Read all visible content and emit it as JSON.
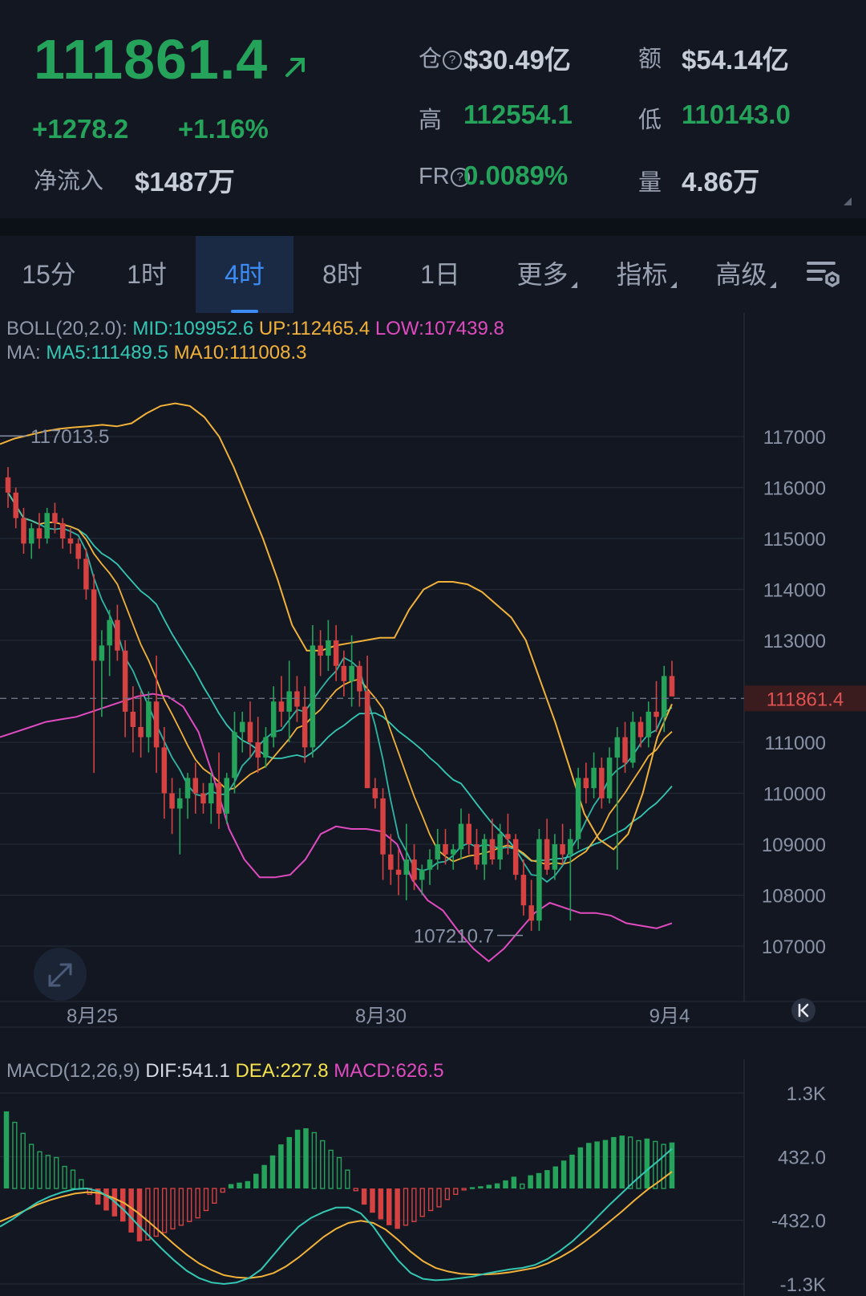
{
  "header": {
    "price": "111861.4",
    "change_abs": "+1278.2",
    "change_pct": "+1.16%",
    "net_inflow_label": "净流入",
    "net_inflow_value": "$1487万",
    "open_interest_label": "仓",
    "open_interest_value": "$30.49亿",
    "turnover_label": "额",
    "turnover_value": "$54.14亿",
    "high_label": "高",
    "high_value": "112554.1",
    "low_label": "低",
    "low_value": "110143.0",
    "funding_rate_label": "FR",
    "funding_rate_value": "0.0089%",
    "volume_label": "量",
    "volume_value": "4.86万",
    "up_color": "#26a35b",
    "down_color": "#d64141"
  },
  "tabs": [
    {
      "label": "15分",
      "active": false
    },
    {
      "label": "1时",
      "active": false
    },
    {
      "label": "4时",
      "active": true
    },
    {
      "label": "8时",
      "active": false
    },
    {
      "label": "1日",
      "active": false
    },
    {
      "label": "更多",
      "active": false
    },
    {
      "label": "指标",
      "active": false
    },
    {
      "label": "高级",
      "active": false
    }
  ],
  "indicators": {
    "boll_name": "BOLL(20,2.0):",
    "boll_mid": "MID:109952.6",
    "boll_up": "UP:112465.4",
    "boll_low": "LOW:107439.8",
    "ma_name": "MA:",
    "ma5": "MA5:111489.5",
    "ma10": "MA10:111008.3",
    "macd_name": "MACD(12,26,9)",
    "macd_dif": "DIF:541.1",
    "macd_dea": "DEA:227.8",
    "macd_val": "MACD:626.5"
  },
  "chart_data": [
    {
      "type": "candlestick",
      "price_axis_ticks": [
        "117000",
        "116000",
        "115000",
        "114000",
        "113000",
        "111000",
        "110000",
        "109000",
        "108000",
        "107000"
      ],
      "current_price_label": "111861.4",
      "x_labels": [
        "8月25",
        "8月30",
        "9月4"
      ],
      "annotations": {
        "high": "117013.5",
        "low": "107210.7"
      },
      "candles": [
        [
          116200,
          116400,
          115600,
          115900
        ],
        [
          115900,
          116000,
          115200,
          115400
        ],
        [
          115400,
          115600,
          114700,
          114900
        ],
        [
          114900,
          115300,
          114600,
          115200
        ],
        [
          115200,
          115500,
          114800,
          115000
        ],
        [
          115000,
          115600,
          114900,
          115500
        ],
        [
          115500,
          115700,
          115100,
          115300
        ],
        [
          115300,
          115400,
          114800,
          115000
        ],
        [
          115000,
          115200,
          114700,
          114900
        ],
        [
          114900,
          115000,
          114400,
          114600
        ],
        [
          114600,
          114800,
          113800,
          114000
        ],
        [
          114000,
          114300,
          110400,
          112600
        ],
        [
          112600,
          113200,
          111500,
          112900
        ],
        [
          112900,
          113600,
          112300,
          113400
        ],
        [
          113400,
          113700,
          112600,
          112800
        ],
        [
          112800,
          113000,
          111100,
          111600
        ],
        [
          111600,
          112100,
          110800,
          111300
        ],
        [
          111300,
          112000,
          110700,
          111100
        ],
        [
          111100,
          112000,
          110800,
          111800
        ],
        [
          111800,
          112700,
          110400,
          110900
        ],
        [
          110900,
          111300,
          109500,
          110000
        ],
        [
          110000,
          110300,
          109200,
          109700
        ],
        [
          109700,
          110100,
          108800,
          109900
        ],
        [
          109900,
          110400,
          109500,
          110300
        ],
        [
          110300,
          110600,
          109600,
          110000
        ],
        [
          110000,
          110200,
          109600,
          109800
        ],
        [
          109800,
          110400,
          109400,
          110200
        ],
        [
          110200,
          110800,
          109300,
          109600
        ],
        [
          109600,
          110400,
          109400,
          110300
        ],
        [
          110300,
          111600,
          110000,
          111200
        ],
        [
          111200,
          111600,
          110800,
          111400
        ],
        [
          111400,
          111800,
          110700,
          111000
        ],
        [
          111000,
          111500,
          110400,
          110700
        ],
        [
          110700,
          111300,
          110500,
          111100
        ],
        [
          111100,
          112100,
          110900,
          111800
        ],
        [
          111800,
          112300,
          111300,
          111600
        ],
        [
          111600,
          112600,
          111000,
          112000
        ],
        [
          112000,
          112300,
          111400,
          111700
        ],
        [
          111700,
          112100,
          110600,
          110900
        ],
        [
          110900,
          113300,
          110700,
          112900
        ],
        [
          112900,
          113200,
          112300,
          112700
        ],
        [
          112700,
          113400,
          112400,
          113000
        ],
        [
          113000,
          113300,
          112200,
          112500
        ],
        [
          112500,
          112800,
          111900,
          112200
        ],
        [
          112200,
          113100,
          111700,
          112500
        ],
        [
          112500,
          112600,
          111700,
          112000
        ],
        [
          112000,
          112700,
          110500,
          110100
        ],
        [
          110100,
          110300,
          109700,
          109900
        ],
        [
          109900,
          110100,
          108300,
          108800
        ],
        [
          108800,
          109200,
          108200,
          108500
        ],
        [
          108500,
          108900,
          108000,
          108400
        ],
        [
          108400,
          109400,
          107900,
          108700
        ],
        [
          108700,
          109000,
          108100,
          108300
        ],
        [
          108300,
          108600,
          108000,
          108500
        ],
        [
          108500,
          108900,
          108200,
          108700
        ],
        [
          108700,
          109300,
          108500,
          109000
        ],
        [
          109000,
          109300,
          108600,
          108800
        ],
        [
          108800,
          109000,
          108500,
          108900
        ],
        [
          108900,
          109700,
          108700,
          109400
        ],
        [
          109400,
          109600,
          108800,
          109000
        ],
        [
          109000,
          109300,
          108500,
          108600
        ],
        [
          108600,
          109200,
          108300,
          109100
        ],
        [
          109100,
          109500,
          108600,
          108700
        ],
        [
          108700,
          109400,
          108500,
          109200
        ],
        [
          109200,
          109600,
          108800,
          109100
        ],
        [
          109100,
          109200,
          108300,
          108400
        ],
        [
          108400,
          108700,
          107600,
          107800
        ],
        [
          107800,
          108300,
          107300,
          107500
        ],
        [
          107500,
          109300,
          107300,
          109100
        ],
        [
          109100,
          109500,
          108400,
          108500
        ],
        [
          108500,
          109200,
          108300,
          109000
        ],
        [
          109000,
          109400,
          108600,
          108800
        ],
        [
          108800,
          109300,
          107500,
          109100
        ],
        [
          109100,
          110500,
          108900,
          110300
        ],
        [
          110300,
          110600,
          109800,
          110100
        ],
        [
          110100,
          110800,
          109900,
          110500
        ],
        [
          110500,
          110700,
          109700,
          109900
        ],
        [
          109900,
          110900,
          109800,
          110700
        ],
        [
          110700,
          111300,
          108500,
          111100
        ],
        [
          111100,
          111400,
          110400,
          110600
        ],
        [
          110600,
          111600,
          110500,
          111400
        ],
        [
          111400,
          111500,
          110900,
          111100
        ],
        [
          111100,
          111800,
          110900,
          111600
        ],
        [
          111600,
          112200,
          111200,
          111500
        ],
        [
          111500,
          112500,
          111200,
          112300
        ],
        [
          112300,
          112600,
          111900,
          111900
        ]
      ],
      "upper_band": [
        116850,
        116960,
        117030,
        117100,
        117150,
        117180,
        117200,
        117230,
        117200,
        117260,
        117450,
        117600,
        117650,
        117600,
        117380,
        117000,
        116400,
        115700,
        115000,
        114200,
        113300,
        112800,
        112800,
        112900,
        112950,
        113000,
        113050,
        113050,
        113600,
        114000,
        114150,
        114150,
        114100,
        113950,
        113700,
        113450,
        113000,
        112200,
        111400,
        110500,
        109600,
        109100,
        108900,
        109200,
        110000,
        111100,
        111750
      ],
      "lower_band": [
        111100,
        111200,
        111300,
        111400,
        111450,
        111500,
        111600,
        111700,
        111800,
        111900,
        111950,
        111900,
        111700,
        111200,
        110300,
        109300,
        108700,
        108350,
        108350,
        108400,
        108700,
        109200,
        109350,
        109300,
        109300,
        109250,
        109000,
        108300,
        107900,
        107700,
        107300,
        106950,
        106700,
        106950,
        107300,
        107650,
        107850,
        107750,
        107650,
        107650,
        107600,
        107450,
        107400,
        107350,
        107450
      ]
    },
    {
      "type": "bar+line",
      "y_axis_ticks": [
        "1.3K",
        "432.0",
        "-432.0",
        "-1.3K"
      ],
      "histogram": [
        1050,
        900,
        750,
        600,
        500,
        450,
        420,
        300,
        250,
        120,
        -80,
        -220,
        -300,
        -380,
        -450,
        -600,
        -720,
        -700,
        -650,
        -600,
        -550,
        -500,
        -450,
        -400,
        -300,
        -200,
        -50,
        60,
        80,
        100,
        200,
        320,
        450,
        600,
        700,
        800,
        820,
        760,
        650,
        520,
        420,
        250,
        -30,
        -220,
        -330,
        -420,
        -500,
        -550,
        -500,
        -450,
        -380,
        -300,
        -250,
        -150,
        -80,
        -20,
        10,
        30,
        50,
        70,
        110,
        160,
        60,
        180,
        210,
        250,
        300,
        380,
        460,
        560,
        620,
        640,
        660,
        700,
        720,
        700,
        650,
        680,
        640,
        600,
        626
      ],
      "dif": [
        -520,
        -420,
        -300,
        -190,
        -110,
        -50,
        -10,
        0,
        -40,
        -150,
        -300,
        -480,
        -650,
        -820,
        -980,
        -1120,
        -1220,
        -1280,
        -1300,
        -1280,
        -1220,
        -1100,
        -900,
        -700,
        -520,
        -400,
        -320,
        -260,
        -260,
        -340,
        -520,
        -760,
        -980,
        -1150,
        -1230,
        -1250,
        -1240,
        -1220,
        -1200,
        -1160,
        -1130,
        -1100,
        -1080,
        -1040,
        -960,
        -850,
        -720,
        -560,
        -390,
        -220,
        -60,
        100,
        250,
        390,
        541
      ],
      "dea": [
        -450,
        -380,
        -300,
        -220,
        -160,
        -110,
        -70,
        -50,
        -60,
        -120,
        -200,
        -320,
        -460,
        -610,
        -760,
        -900,
        -1020,
        -1110,
        -1180,
        -1210,
        -1220,
        -1200,
        -1150,
        -1060,
        -940,
        -800,
        -660,
        -550,
        -470,
        -440,
        -470,
        -560,
        -700,
        -860,
        -990,
        -1080,
        -1130,
        -1160,
        -1170,
        -1170,
        -1160,
        -1140,
        -1110,
        -1080,
        -1020,
        -940,
        -840,
        -720,
        -590,
        -450,
        -310,
        -160,
        -20,
        100,
        228
      ]
    }
  ]
}
